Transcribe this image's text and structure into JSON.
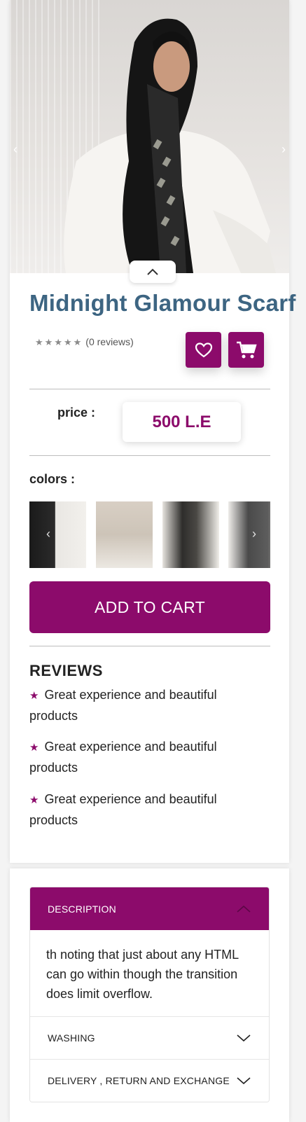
{
  "product": {
    "title": "Midnight Glamour Scarf",
    "rating": {
      "stars": 5,
      "filled": 0,
      "reviews_text": "(0 reviews)"
    },
    "price_label": "price :",
    "price": "500 L.E",
    "colors_label": "colors :",
    "color_swatches": [
      "black-scarf",
      "beige-scarf",
      "black-pattern-scarf",
      "grey-scarf"
    ],
    "add_to_cart_label": "ADD TO CART"
  },
  "gallery": {
    "prev_icon": "chevron-left-icon",
    "next_icon": "chevron-right-icon",
    "collapse_icon": "chevron-up-icon"
  },
  "actions": {
    "wishlist_icon": "heart-icon",
    "cart_icon": "cart-icon"
  },
  "reviews": {
    "heading": "REVIEWS",
    "items": [
      "Great experience and beautiful products",
      "Great experience and beautiful products",
      "Great experience and beautiful products"
    ]
  },
  "accordion": {
    "sections": [
      {
        "label": "DESCRIPTION",
        "expanded": true,
        "body": "th noting that just about any HTML can go within though the transition does limit overflow."
      },
      {
        "label": "WASHING",
        "expanded": false
      },
      {
        "label": "DELIVERY , RETURN AND EXCHANGE",
        "expanded": false
      }
    ]
  },
  "colors": {
    "accent": "#8c0b6b",
    "title": "#3d6582"
  }
}
